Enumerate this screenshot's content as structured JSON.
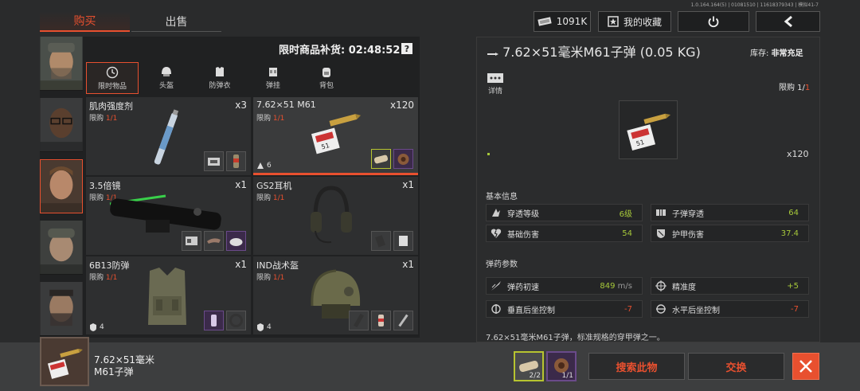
{
  "version": "1.0.164.164(5) | 01081510 | 11618379343 | 模拟41-7",
  "tabs": {
    "buy": "购买",
    "sell": "出售"
  },
  "topbar": {
    "currency": "1091K",
    "favorites": "我的收藏"
  },
  "left": {
    "restock_label": "限时商品补货: 02:48:52",
    "help": "?",
    "categories": [
      {
        "label": "限时物品",
        "icon": "clock-icon"
      },
      {
        "label": "头盔",
        "icon": "helmet-icon"
      },
      {
        "label": "防弹衣",
        "icon": "vest-icon"
      },
      {
        "label": "弹挂",
        "icon": "rig-icon"
      },
      {
        "label": "背包",
        "icon": "backpack-icon"
      }
    ],
    "items": [
      {
        "name": "肌肉强度剂",
        "limit_prefix": "限购 ",
        "limit": "1/1",
        "qty": "x3",
        "badge": ""
      },
      {
        "name": "7.62×51 M61",
        "limit_prefix": "限购 ",
        "limit": "1/1",
        "qty": "x120",
        "badge": "6"
      },
      {
        "name": "3.5倍镜",
        "limit_prefix": "限购 ",
        "limit": "1/1",
        "qty": "x1",
        "badge": ""
      },
      {
        "name": "GS2耳机",
        "limit_prefix": "限购 ",
        "limit": "1/1",
        "qty": "x1",
        "badge": ""
      },
      {
        "name": "6B13防弹",
        "limit_prefix": "限购 ",
        "limit": "1/1",
        "qty": "x1",
        "badge": "4"
      },
      {
        "name": "IND战术盔",
        "limit_prefix": "限购 ",
        "limit": "1/1",
        "qty": "x1",
        "badge": "4"
      }
    ]
  },
  "right": {
    "title": "7.62×51毫米M61子弹 (0.05 KG)",
    "stock_label": "库存:",
    "stock_value": "非常充足",
    "details_label": "详情",
    "limit_prefix": "限购 1/",
    "limit_value": "1",
    "qty": "x120",
    "section_basic": "基本信息",
    "stats_basic": [
      {
        "label": "穿透等级",
        "value": "6级",
        "icon": "penetration-icon"
      },
      {
        "label": "子弹穿透",
        "value": "64",
        "icon": "bullet-pen-icon"
      },
      {
        "label": "基础伤害",
        "value": "54",
        "icon": "broken-heart-icon"
      },
      {
        "label": "护甲伤害",
        "value": "37.4",
        "icon": "armor-damage-icon"
      }
    ],
    "section_ammo": "弹药参数",
    "stats_ammo": [
      {
        "label": "弹药初速",
        "value": "849",
        "unit": "m/s",
        "icon": "velocity-icon"
      },
      {
        "label": "精准度",
        "value": "+5",
        "icon": "crosshair-icon"
      },
      {
        "label": "垂直后坐控制",
        "value": "-7",
        "icon": "vertical-recoil-icon"
      },
      {
        "label": "水平后坐控制",
        "value": "-7",
        "icon": "horizontal-recoil-icon"
      }
    ],
    "description": "7.62×51毫米M61子弹，标准规格的穿甲弹之一。"
  },
  "bottom": {
    "selected_name_line1": "7.62×51毫米",
    "selected_name_line2": "M61子弹",
    "cost1": "2/2",
    "cost2": "1/1",
    "search_btn": "搜索此物",
    "trade_btn": "交换"
  },
  "colors": {
    "accent": "#e8502f",
    "positive": "#a6c83a",
    "background": "#2a2b2c"
  }
}
